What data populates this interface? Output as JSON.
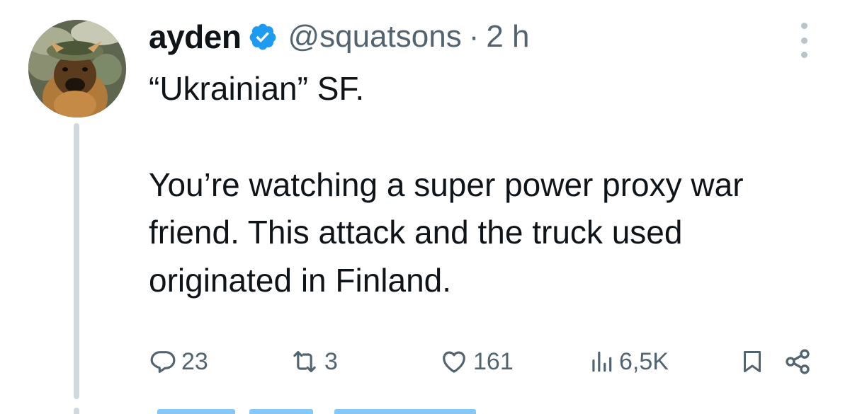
{
  "author": {
    "display_name": "ayden",
    "handle": "@squatsons",
    "separator": "·",
    "time": "2 h",
    "verified_icon": "verified-badge-icon",
    "avatar": "dog-with-helmet-avatar"
  },
  "tweet": {
    "paragraphs": [
      "“Ukrainian” SF.",
      "You’re watching a super power proxy war friend. This attack and the truck used originated in Finland."
    ]
  },
  "actions": {
    "replies": "23",
    "retweets": "3",
    "likes": "161",
    "views": "6,5K"
  },
  "colors": {
    "accent": "#1d9bf0",
    "text": "#0f1419",
    "muted": "#536471",
    "thread_line": "#cfd9de"
  }
}
